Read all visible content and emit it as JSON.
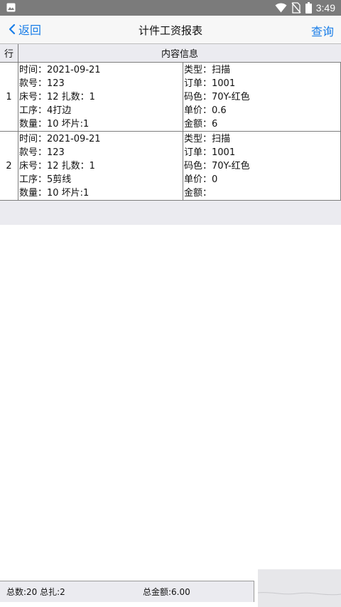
{
  "statusbar": {
    "time": "3:49",
    "icons": [
      "gallery-icon",
      "wifi-icon",
      "no-sim-icon",
      "battery-icon"
    ]
  },
  "navbar": {
    "back_label": "返回",
    "title": "计件工资报表",
    "query_label": "查询"
  },
  "table": {
    "headers": {
      "index": "行",
      "content": "内容信息"
    },
    "rows": [
      {
        "index": "1",
        "left": [
          "时间：2021-09-21",
          "款号：123",
          "床号：12 扎数：1",
          "工序：4打边",
          "数量：10 坏片:1"
        ],
        "right": [
          "类型：扫描",
          "订单：1001",
          "码色：70Y-红色",
          "单价：0.6",
          "金额：6"
        ]
      },
      {
        "index": "2",
        "left": [
          "时间：2021-09-21",
          "款号：123",
          "床号：12 扎数：1",
          "工序：5剪线",
          "数量：10 坏片:1"
        ],
        "right": [
          "类型：扫描",
          "订单：1001",
          "码色：70Y-红色",
          "单价：0",
          "金额："
        ]
      }
    ]
  },
  "footer": {
    "totals": "总数:20 总扎:2",
    "total_amount": "总金额:6.00"
  },
  "colors": {
    "accent": "#1a7ee8",
    "statusbar": "#7b7b7b",
    "navbar": "#f7f7f7",
    "header_bg": "#ebebf0"
  }
}
